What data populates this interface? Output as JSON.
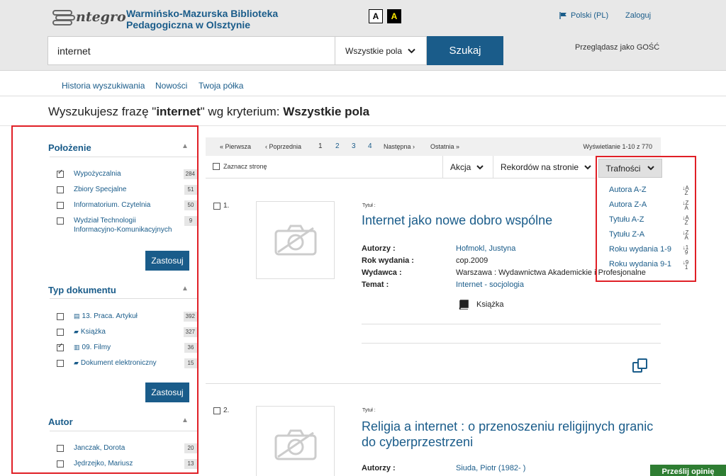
{
  "header": {
    "logo_text": "ntegro",
    "library_name": "Warmińsko-Mazurska Biblioteka Pedagogiczna w Olsztynie",
    "contrast_normal": "A",
    "contrast_high": "A",
    "language": "Polski (PL)",
    "login": "Zaloguj",
    "guest_text": "Przeglądasz jako GOŚĆ"
  },
  "search": {
    "query": "internet",
    "field_select": "Wszystkie pola",
    "button": "Szukaj"
  },
  "nav": {
    "items": [
      "Historia wyszukiwania",
      "Nowości",
      "Twoja półka"
    ]
  },
  "headline": {
    "prefix": "Wyszukujesz frazę \"",
    "phrase": "internet",
    "middle": "\" wg kryterium: ",
    "criterion": "Wszystkie pola"
  },
  "facets": [
    {
      "title": "Położenie",
      "items": [
        {
          "label": "Wypożyczalnia",
          "count": "284",
          "checked": true
        },
        {
          "label": "Zbiory Specjalne",
          "count": "51",
          "checked": false
        },
        {
          "label": "Informatorium. Czytelnia",
          "count": "50",
          "checked": false
        },
        {
          "label": "Wydział Technologii Informacyjno-Komunikacyjnych",
          "count": "9",
          "checked": false
        }
      ],
      "apply": "Zastosuj"
    },
    {
      "title": "Typ dokumentu",
      "items": [
        {
          "label": "13. Praca. Artykuł",
          "count": "392",
          "checked": false,
          "icon": "article-icon"
        },
        {
          "label": "Książka",
          "count": "327",
          "checked": false,
          "icon": "book-icon"
        },
        {
          "label": "09. Filmy",
          "count": "36",
          "checked": true,
          "icon": "film-icon"
        },
        {
          "label": "Dokument elektroniczny",
          "count": "15",
          "checked": false,
          "icon": "ebook-icon"
        }
      ],
      "apply": "Zastosuj"
    },
    {
      "title": "Autor",
      "items": [
        {
          "label": "Janczak, Dorota",
          "count": "20",
          "checked": false
        },
        {
          "label": "Jędrzejko, Mariusz",
          "count": "13",
          "checked": false
        }
      ]
    }
  ],
  "pager": {
    "first": "« Pierwsza",
    "prev": "‹ Poprzednia",
    "pages": [
      "1",
      "2",
      "3",
      "4"
    ],
    "current": "1",
    "next": "Następna ›",
    "last": "Ostatnia »",
    "info": "Wyświetlanie 1-10 z 770"
  },
  "toolbar": {
    "mark_page": "Zaznacz stronę",
    "action": "Akcja",
    "records_per_page": "Rekordów na stronie",
    "sort": "Trafności"
  },
  "sort_options": [
    {
      "label": "Autora A-Z",
      "icon": "sort-alpha-asc-icon"
    },
    {
      "label": "Autora Z-A",
      "icon": "sort-alpha-desc-icon"
    },
    {
      "label": "Tytułu A-Z",
      "icon": "sort-alpha-asc-icon"
    },
    {
      "label": "Tytułu Z-A",
      "icon": "sort-alpha-desc-icon"
    },
    {
      "label": "Roku wydania 1-9",
      "icon": "sort-numeric-asc-icon"
    },
    {
      "label": "Roku wydania 9-1",
      "icon": "sort-numeric-desc-icon"
    }
  ],
  "results": [
    {
      "number": "1.",
      "title_label": "Tytuł :",
      "title": "Internet jako nowe dobro wspólne",
      "meta": [
        {
          "key": "Autorzy :",
          "value": "Hofmokl, Justyna",
          "link": true
        },
        {
          "key": "Rok wydania :",
          "value": "cop.2009",
          "link": false
        },
        {
          "key": "Wydawca :",
          "value": "Warszawa : Wydawnictwa Akademickie i Profesjonalne",
          "link": false
        },
        {
          "key": "Temat :",
          "value": "Internet - socjologia",
          "link": true
        }
      ],
      "doc_type": "Książka"
    },
    {
      "number": "2.",
      "title_label": "Tytuł :",
      "title": "Religia a internet : o przenoszeniu religijnych granic do cyberprzestrzeni",
      "meta": [
        {
          "key": "Autorzy :",
          "value": "Siuda, Piotr (1982- )",
          "link": true
        }
      ]
    }
  ],
  "feedback": "Prześlij opinię",
  "colors": {
    "primary": "#1a5c8a",
    "highlight_border": "#e01f26",
    "feedback_bg": "#2e7d32"
  }
}
